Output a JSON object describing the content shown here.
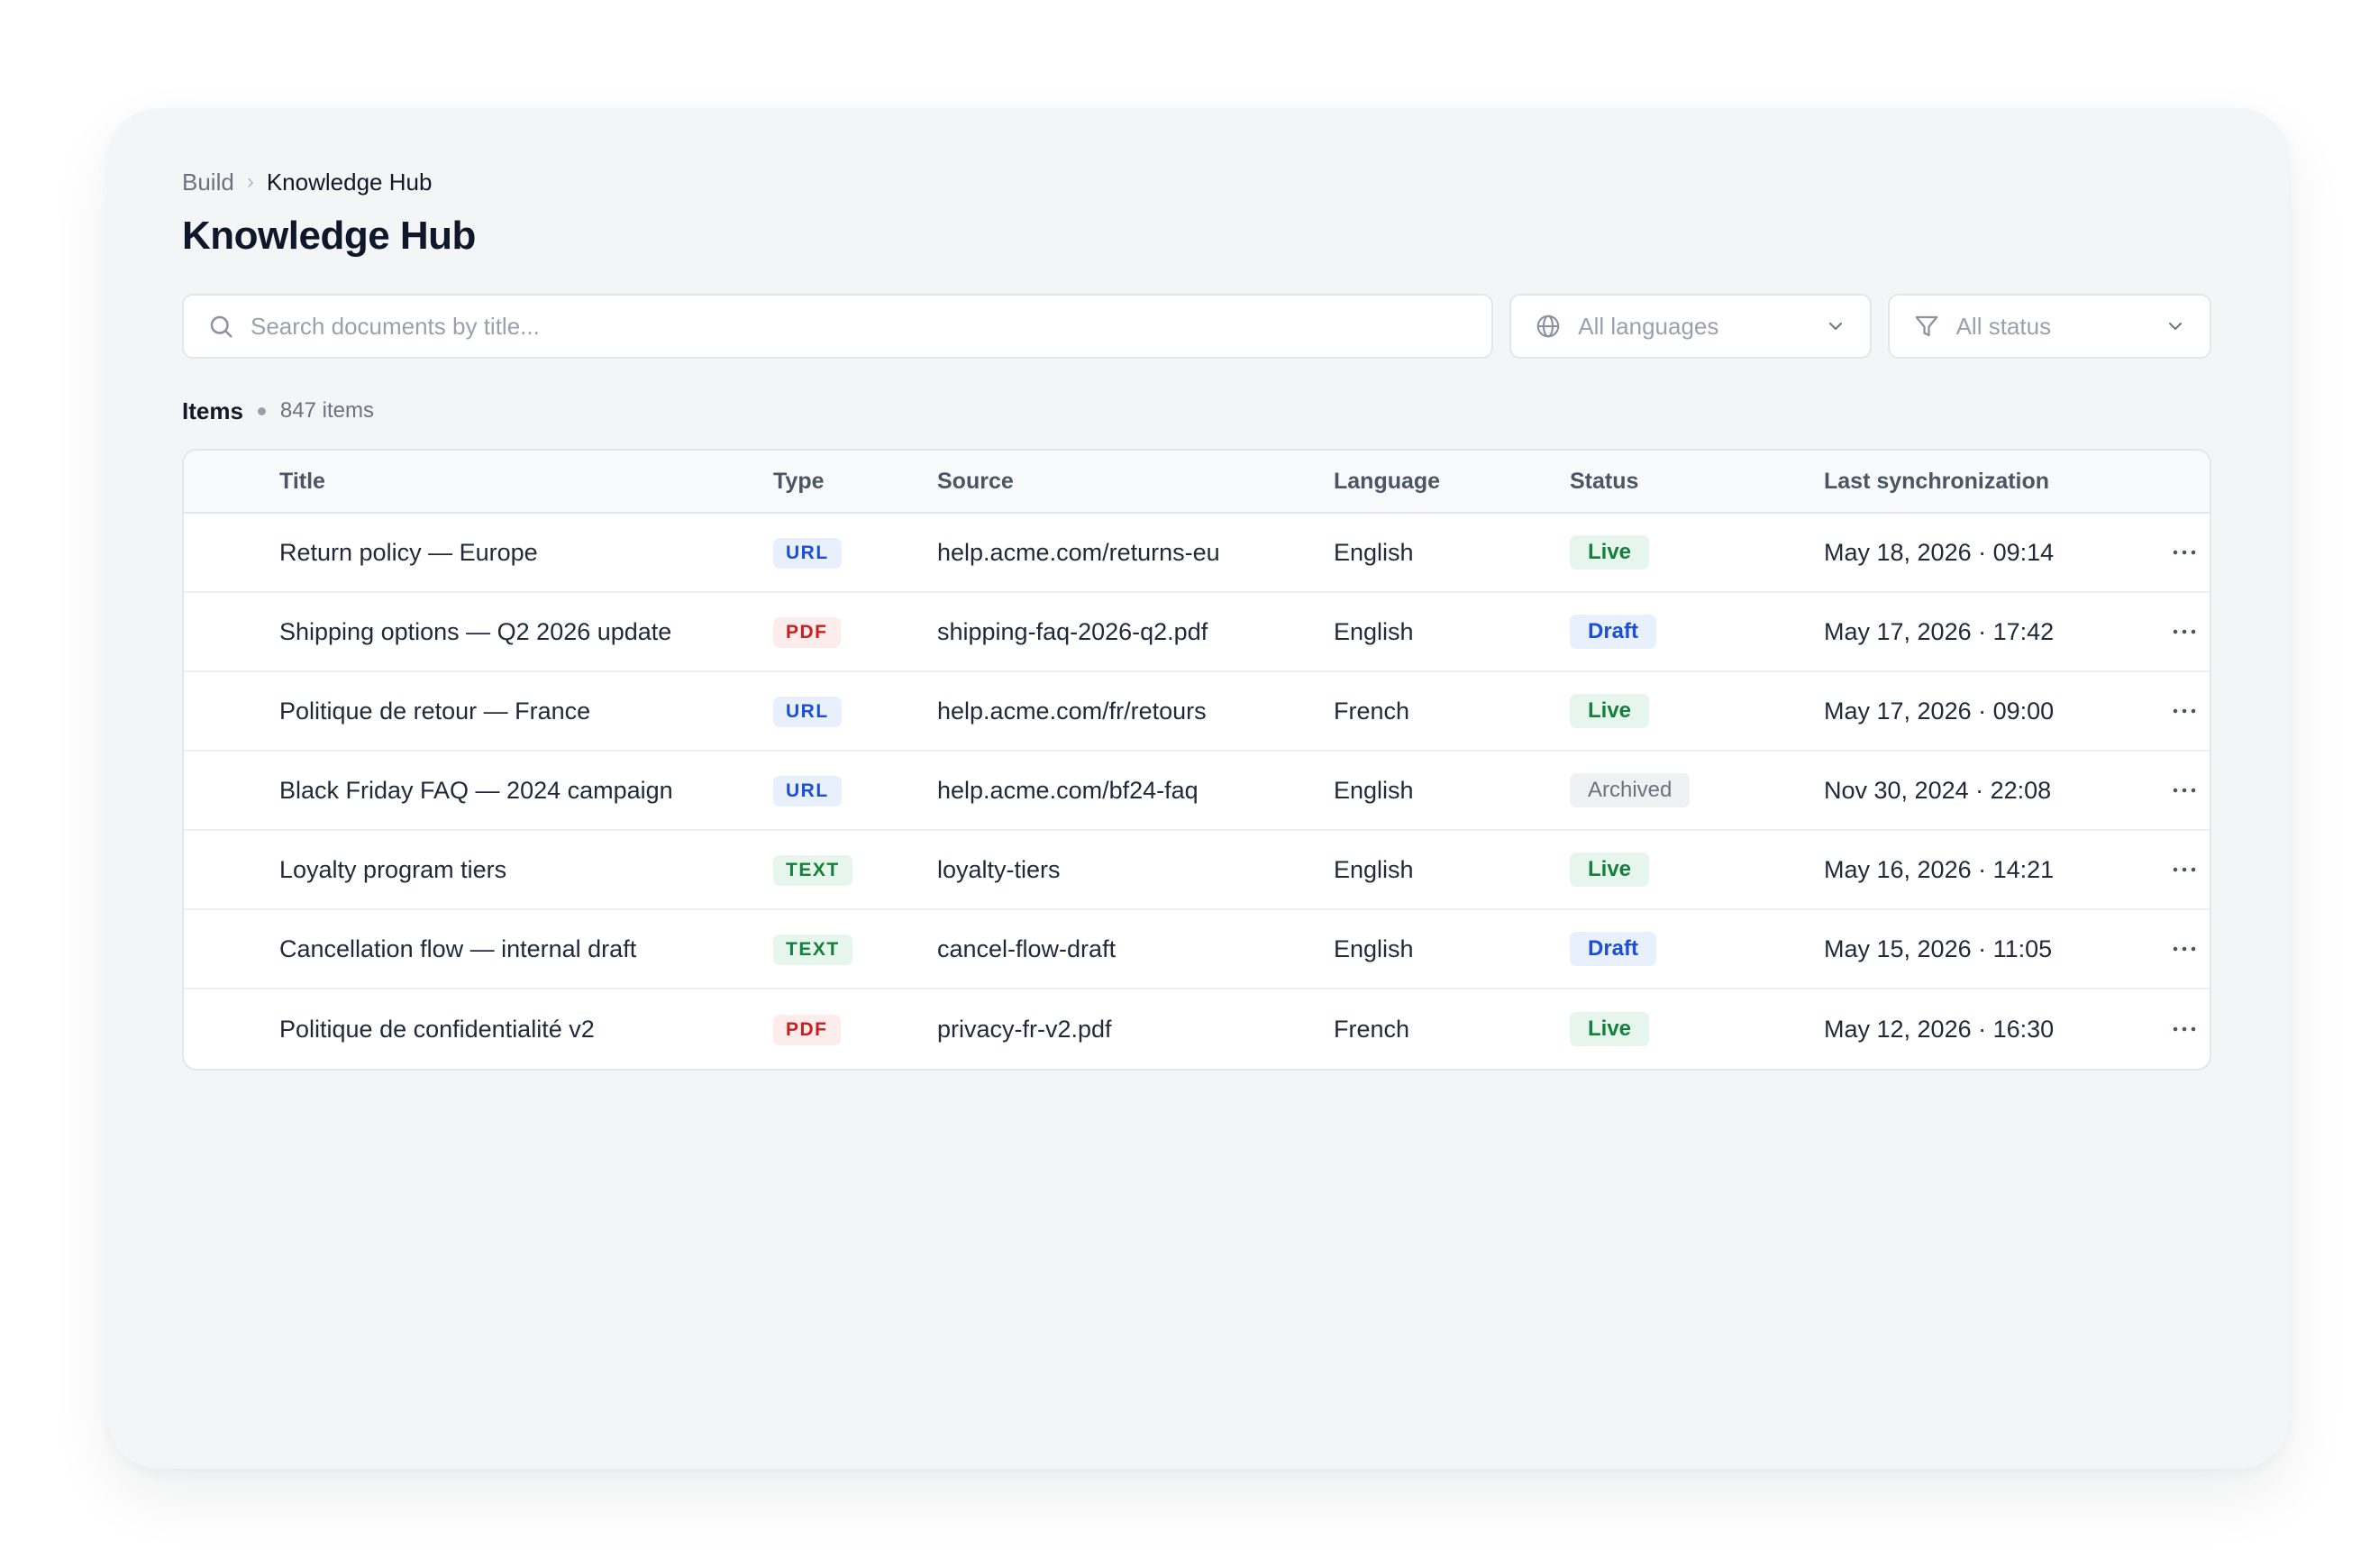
{
  "breadcrumb": {
    "parent": "Build",
    "separator": "›",
    "current": "Knowledge Hub"
  },
  "page": {
    "title": "Knowledge Hub"
  },
  "filters": {
    "search_placeholder": "Search documents by title...",
    "language": "All languages",
    "status": "All status"
  },
  "items": {
    "label": "Items",
    "count": "847 items"
  },
  "columns": {
    "title": "Title",
    "type": "Type",
    "source": "Source",
    "language": "Language",
    "status": "Status",
    "sync": "Last synchronization"
  },
  "rows": [
    {
      "title": "Return policy — Europe",
      "type": "URL",
      "source": "help.acme.com/returns-eu",
      "language": "English",
      "status": "Live",
      "sync": "May 18, 2026 · 09:14"
    },
    {
      "title": "Shipping options — Q2 2026 update",
      "type": "PDF",
      "source": "shipping-faq-2026-q2.pdf",
      "language": "English",
      "status": "Draft",
      "sync": "May 17, 2026 · 17:42"
    },
    {
      "title": "Politique de retour — France",
      "type": "URL",
      "source": "help.acme.com/fr/retours",
      "language": "French",
      "status": "Live",
      "sync": "May 17, 2026 · 09:00"
    },
    {
      "title": "Black Friday FAQ — 2024 campaign",
      "type": "URL",
      "source": "help.acme.com/bf24-faq",
      "language": "English",
      "status": "Archived",
      "sync": "Nov 30, 2024 · 22:08"
    },
    {
      "title": "Loyalty program tiers",
      "type": "TEXT",
      "source": "loyalty-tiers",
      "language": "English",
      "status": "Live",
      "sync": "May 16, 2026 · 14:21"
    },
    {
      "title": "Cancellation flow — internal draft",
      "type": "TEXT",
      "source": "cancel-flow-draft",
      "language": "English",
      "status": "Draft",
      "sync": "May 15, 2026 · 11:05"
    },
    {
      "title": "Politique de confidentialité v2",
      "type": "PDF",
      "source": "privacy-fr-v2.pdf",
      "language": "French",
      "status": "Live",
      "sync": "May 12, 2026 · 16:30"
    }
  ],
  "icons": {
    "search": "search-icon",
    "language": "globe-icon",
    "status": "filter-icon",
    "dropdown": "chevron-down-icon",
    "row_actions": "more-horizontal-icon"
  },
  "colors": {
    "live": "#15803d",
    "draft": "#1d4ed8",
    "archived": "#6b7280",
    "pdf": "#c81e1e"
  }
}
